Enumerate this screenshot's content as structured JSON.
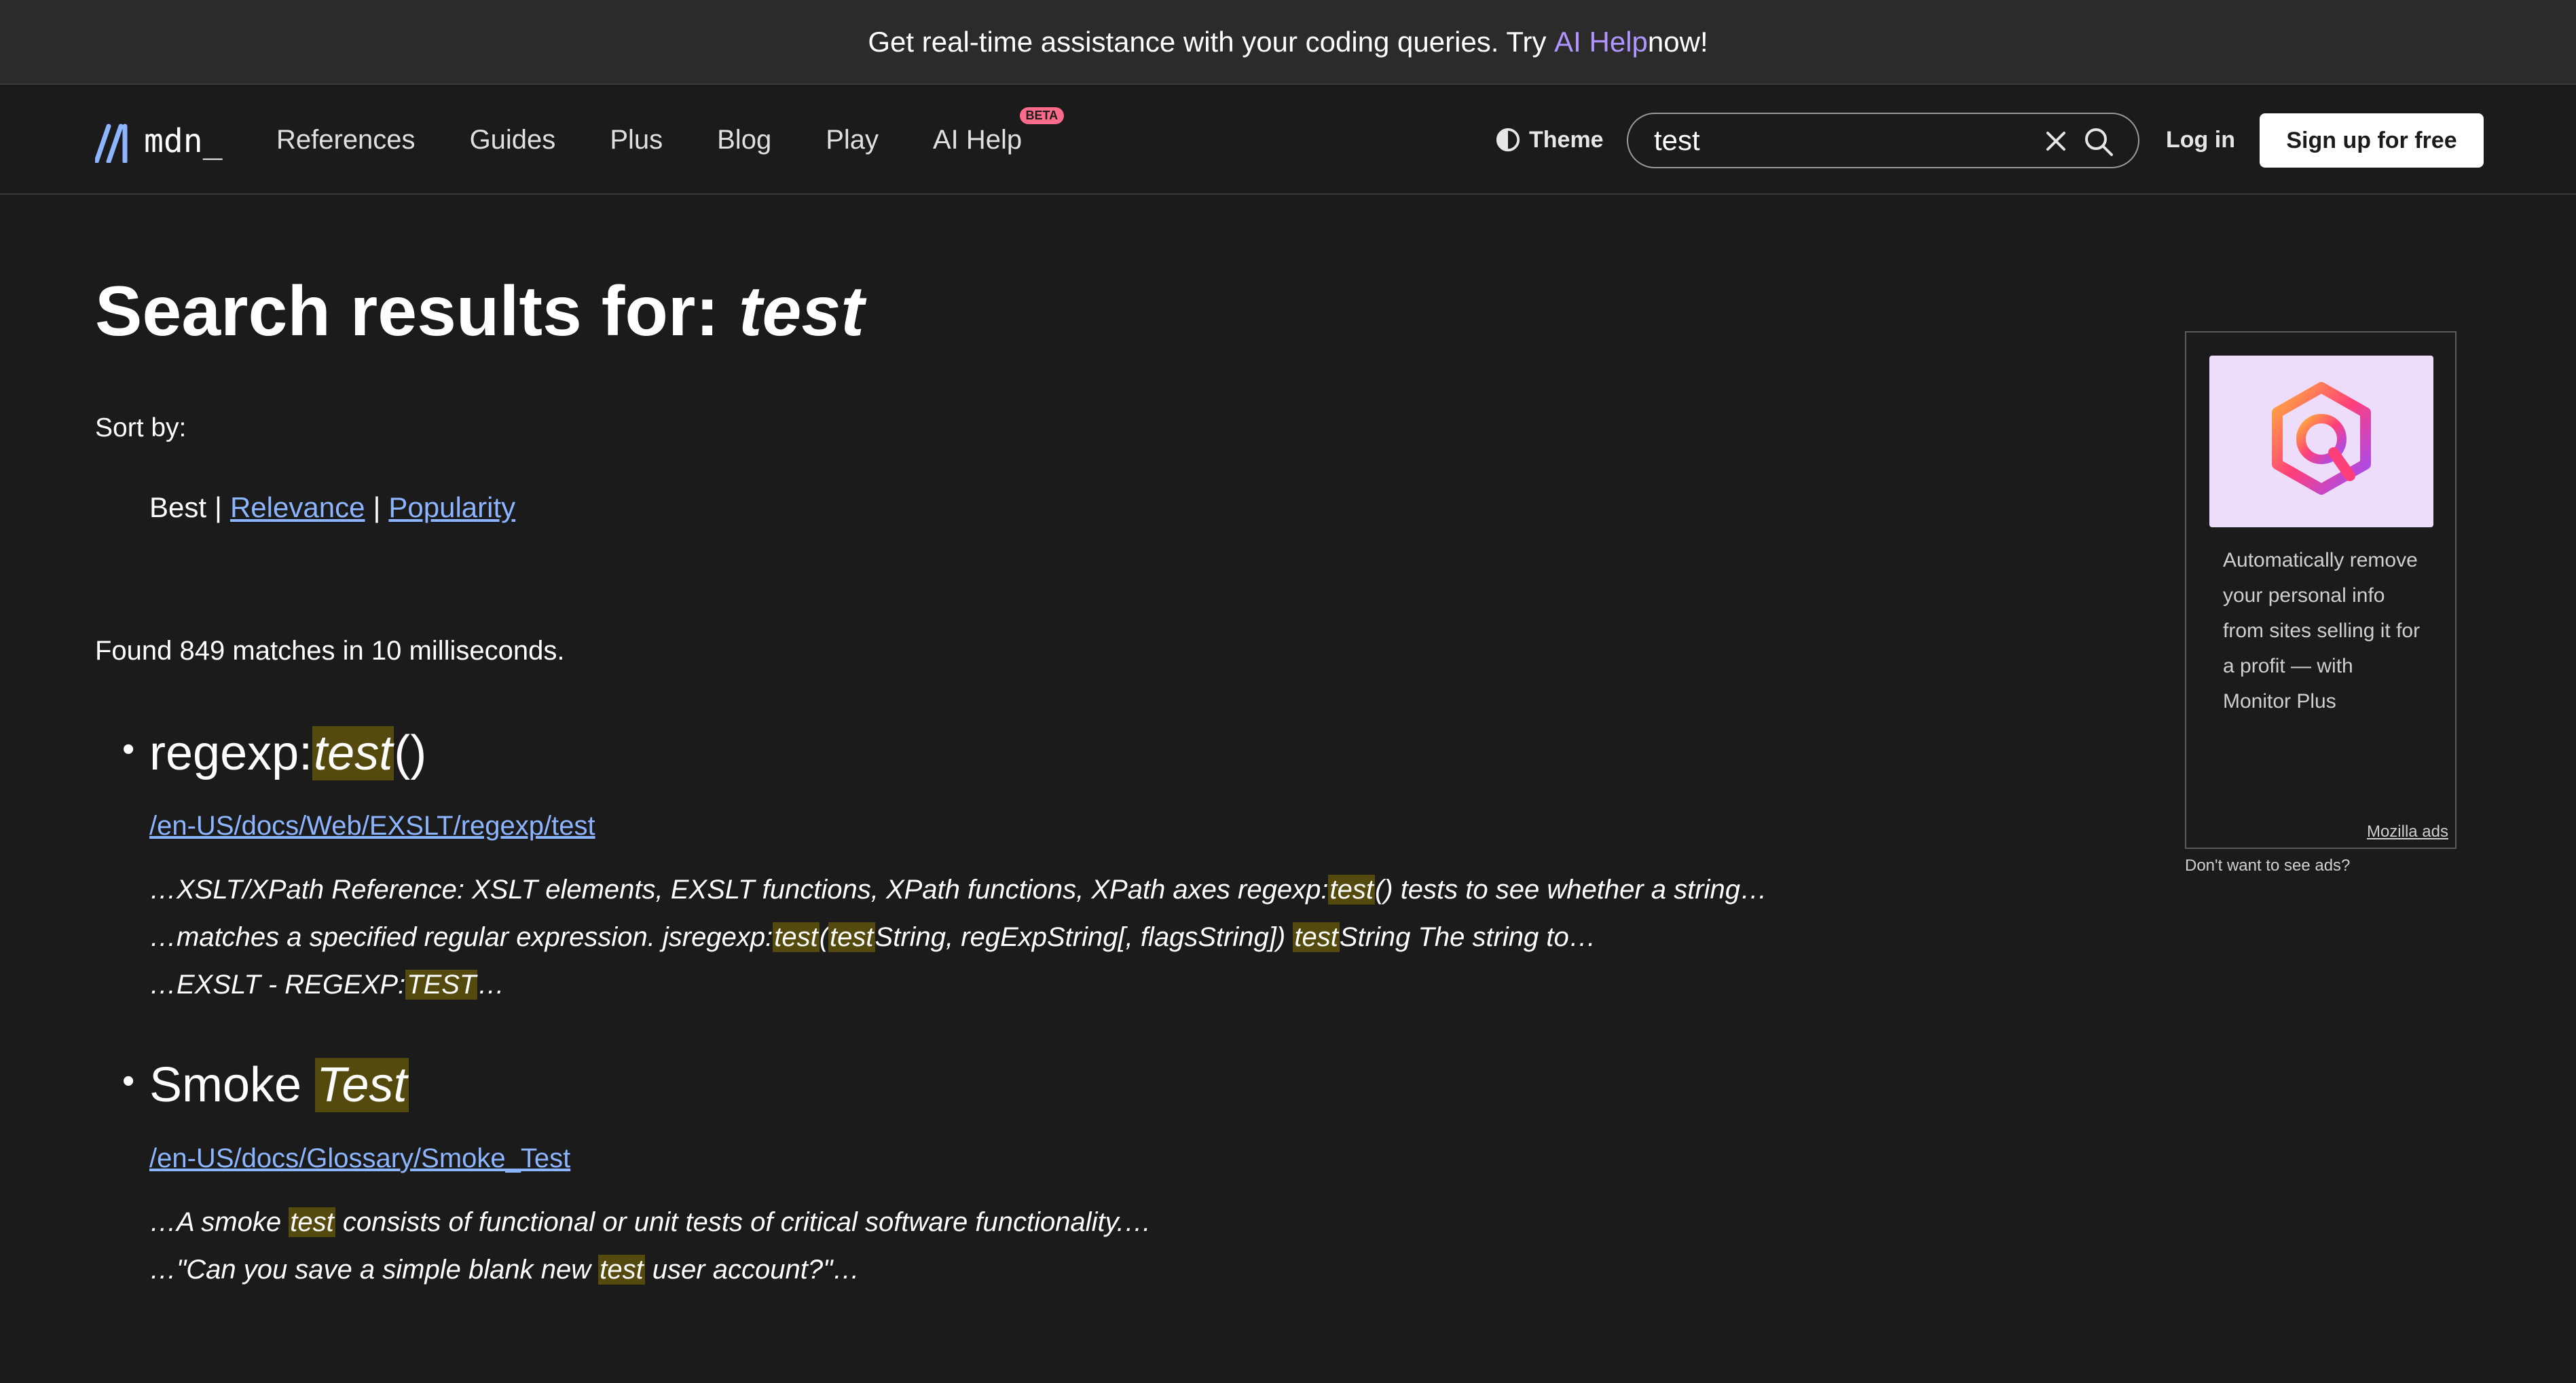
{
  "banner": {
    "text_before": "Get real-time assistance with your coding queries. Try ",
    "link": "AI Help",
    "text_after": " now!"
  },
  "nav": {
    "logo_text": "mdn_",
    "links": [
      "References",
      "Guides",
      "Plus",
      "Blog",
      "Play",
      "AI Help"
    ],
    "beta_badge": "BETA",
    "theme_label": "Theme",
    "search_value": "test",
    "login_label": "Log in",
    "signup_label": "Sign up for free"
  },
  "main": {
    "title_prefix": "Search results for: ",
    "title_query": "test",
    "sort_label": "Sort by:",
    "sort_options": [
      "Best",
      "Relevance",
      "Popularity"
    ],
    "found_text": "Found 849 matches in 10 milliseconds."
  },
  "results": [
    {
      "title_plain": "regexp:",
      "title_hl": "test",
      "title_after": "()",
      "url": "/en-US/docs/Web/EXSLT/regexp/test"
    },
    {
      "title_plain": "Smoke ",
      "title_hl": "Test",
      "title_after": "",
      "url": "/en-US/docs/Glossary/Smoke_Test"
    }
  ],
  "snippets": {
    "r1_line1_a": "…XSLT/XPath Reference: XSLT elements, EXSLT functions, XPath functions, XPath axes regexp:",
    "r1_line1_hl": "test",
    "r1_line1_b": "() tests to see whether a string…",
    "r1_line2_a": "…matches a specified regular expression. jsregexp:",
    "r1_line2_hl1": "test",
    "r1_line2_b": "(",
    "r1_line2_hl2": "test",
    "r1_line2_c": "String, regExpString[, flagsString]) ",
    "r1_line2_hl3": "test",
    "r1_line2_d": "String The string to…",
    "r1_line3_a": "…EXSLT - REGEXP:",
    "r1_line3_hl": "TEST",
    "r1_line3_b": "…",
    "r2_line1_a": "…A smoke ",
    "r2_line1_hl": "test",
    "r2_line1_b": " consists of functional or unit tests of critical software functionality.…",
    "r2_line2_a": "…\"Can you save a simple blank new ",
    "r2_line2_hl": "test",
    "r2_line2_b": " user account?\"…"
  },
  "ad": {
    "text": "Automatically remove your personal info from sites selling it for a profit — with Monitor Plus",
    "credit": "Mozilla ads",
    "no_ads": "Don't want to see ads?"
  },
  "colors": {
    "background": "#1b1b1b",
    "banner": "#2b2b2b",
    "link": "#8cb4ff",
    "ai_link": "#b094ff",
    "highlight": "#554a0e",
    "beta": "#ff6b8b"
  }
}
